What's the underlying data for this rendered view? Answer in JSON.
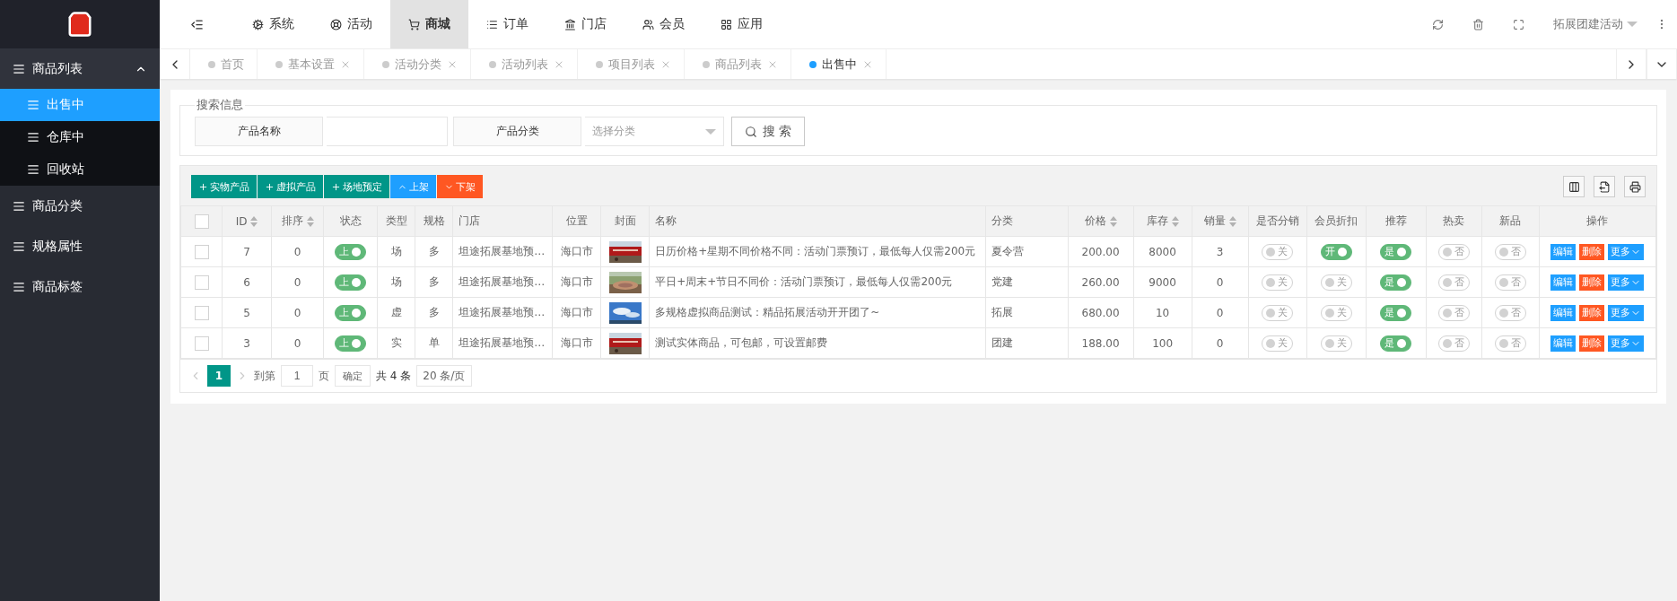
{
  "topnav": {
    "items": [
      {
        "label": "系统",
        "selected": false
      },
      {
        "label": "活动",
        "selected": false
      },
      {
        "label": "商城",
        "selected": true
      },
      {
        "label": "订单",
        "selected": false
      },
      {
        "label": "门店",
        "selected": false
      },
      {
        "label": "会员",
        "selected": false
      },
      {
        "label": "应用",
        "selected": false
      }
    ],
    "user": "拓展团建活动"
  },
  "sidebar": {
    "items": [
      {
        "label": "商品列表",
        "expanded": true,
        "children": [
          {
            "label": "出售中",
            "selected": true
          },
          {
            "label": "仓库中",
            "selected": false
          },
          {
            "label": "回收站",
            "selected": false
          }
        ]
      },
      {
        "label": "商品分类"
      },
      {
        "label": "规格属性"
      },
      {
        "label": "商品标签"
      }
    ]
  },
  "tabs": [
    {
      "label": "首页",
      "selected": false,
      "closable": false
    },
    {
      "label": "基本设置",
      "selected": false,
      "closable": true
    },
    {
      "label": "活动分类",
      "selected": false,
      "closable": true
    },
    {
      "label": "活动列表",
      "selected": false,
      "closable": true
    },
    {
      "label": "项目列表",
      "selected": false,
      "closable": true
    },
    {
      "label": "商品列表",
      "selected": false,
      "closable": true
    },
    {
      "label": "出售中",
      "selected": true,
      "closable": true
    }
  ],
  "search": {
    "legend": "搜索信息",
    "name_label": "产品名称",
    "category_label": "产品分类",
    "category_placeholder": "选择分类",
    "button": "搜 索"
  },
  "toolbar": {
    "buttons": [
      {
        "label": "实物产品",
        "kind": "add"
      },
      {
        "label": "虚拟产品",
        "kind": "add"
      },
      {
        "label": "场地预定",
        "kind": "add"
      },
      {
        "label": "上架",
        "kind": "up"
      },
      {
        "label": "下架",
        "kind": "down"
      }
    ]
  },
  "table": {
    "header_checked": false,
    "columns": [
      {
        "label": "ID",
        "sortable": true
      },
      {
        "label": "排序",
        "sortable": true
      },
      {
        "label": "状态",
        "sortable": false
      },
      {
        "label": "类型",
        "sortable": false
      },
      {
        "label": "规格",
        "sortable": false
      },
      {
        "label": "门店",
        "sortable": false
      },
      {
        "label": "位置",
        "sortable": false
      },
      {
        "label": "封面",
        "sortable": false
      },
      {
        "label": "名称",
        "sortable": false
      },
      {
        "label": "分类",
        "sortable": false
      },
      {
        "label": "价格",
        "sortable": true
      },
      {
        "label": "库存",
        "sortable": true
      },
      {
        "label": "销量",
        "sortable": true
      },
      {
        "label": "是否分销",
        "sortable": false
      },
      {
        "label": "会员折扣",
        "sortable": false
      },
      {
        "label": "推荐",
        "sortable": false
      },
      {
        "label": "热卖",
        "sortable": false
      },
      {
        "label": "新品",
        "sortable": false
      },
      {
        "label": "操作",
        "sortable": false
      }
    ],
    "rows": [
      {
        "checked": false,
        "id": "7",
        "sort": "0",
        "status": {
          "label": "上",
          "on": true
        },
        "type": "场",
        "spec": "多",
        "store": "坦途拓展基地预…",
        "location": "海口市",
        "cover": {
          "kind": "picture"
        },
        "name": "日历价格+星期不同价格不同：活动门票预订，最低每人仅需200元",
        "category": "夏令营",
        "price": "200.00",
        "stock": "8000",
        "sales": "3",
        "distribution": {
          "label": "关",
          "on": false
        },
        "member_discount": {
          "label": "开",
          "on": true
        },
        "recommend": {
          "label": "是",
          "on": true
        },
        "hot": {
          "label": "否",
          "on": false
        },
        "new": {
          "label": "否",
          "on": false
        },
        "actions": [
          {
            "label": "编辑",
            "kind": "edit"
          },
          {
            "label": "删除",
            "kind": "delete"
          },
          {
            "label": "更多",
            "kind": "more"
          }
        ]
      },
      {
        "checked": false,
        "id": "6",
        "sort": "0",
        "status": {
          "label": "上",
          "on": true
        },
        "type": "场",
        "spec": "多",
        "store": "坦途拓展基地预…",
        "location": "海口市",
        "cover": {
          "kind": "picture"
        },
        "name": "平日+周末+节日不同价：活动门票预订，最低每人仅需200元",
        "category": "党建",
        "price": "260.00",
        "stock": "9000",
        "sales": "0",
        "distribution": {
          "label": "关",
          "on": false
        },
        "member_discount": {
          "label": "关",
          "on": false
        },
        "recommend": {
          "label": "是",
          "on": true
        },
        "hot": {
          "label": "否",
          "on": false
        },
        "new": {
          "label": "否",
          "on": false
        },
        "actions": [
          {
            "label": "编辑",
            "kind": "edit"
          },
          {
            "label": "删除",
            "kind": "delete"
          },
          {
            "label": "更多",
            "kind": "more"
          }
        ]
      },
      {
        "checked": false,
        "id": "5",
        "sort": "0",
        "status": {
          "label": "上",
          "on": true
        },
        "type": "虚",
        "spec": "多",
        "store": "坦途拓展基地预…",
        "location": "海口市",
        "cover": {
          "kind": "picture"
        },
        "name": "多规格虚拟商品测试：精品拓展活动开开团了~",
        "category": "拓展",
        "price": "680.00",
        "stock": "10",
        "sales": "0",
        "distribution": {
          "label": "关",
          "on": false
        },
        "member_discount": {
          "label": "关",
          "on": false
        },
        "recommend": {
          "label": "是",
          "on": true
        },
        "hot": {
          "label": "否",
          "on": false
        },
        "new": {
          "label": "否",
          "on": false
        },
        "actions": [
          {
            "label": "编辑",
            "kind": "edit"
          },
          {
            "label": "删除",
            "kind": "delete"
          },
          {
            "label": "更多",
            "kind": "more"
          }
        ]
      },
      {
        "checked": false,
        "id": "3",
        "sort": "0",
        "status": {
          "label": "上",
          "on": true
        },
        "type": "实",
        "spec": "单",
        "store": "坦途拓展基地预…",
        "location": "海口市",
        "cover": {
          "kind": "picture"
        },
        "name": "测试实体商品，可包邮，可设置邮费",
        "category": "团建",
        "price": "188.00",
        "stock": "100",
        "sales": "0",
        "distribution": {
          "label": "关",
          "on": false
        },
        "member_discount": {
          "label": "关",
          "on": false
        },
        "recommend": {
          "label": "是",
          "on": true
        },
        "hot": {
          "label": "否",
          "on": false
        },
        "new": {
          "label": "否",
          "on": false
        },
        "actions": [
          {
            "label": "编辑",
            "kind": "edit"
          },
          {
            "label": "删除",
            "kind": "delete"
          },
          {
            "label": "更多",
            "kind": "more"
          }
        ]
      }
    ]
  },
  "pagination": {
    "pages": [
      {
        "label": "1",
        "selected": true
      }
    ],
    "goto_label": "到第",
    "goto_value": "1",
    "page_unit": "页",
    "confirm": "确定",
    "total": "共 4 条",
    "page_size": "20 条/页"
  }
}
